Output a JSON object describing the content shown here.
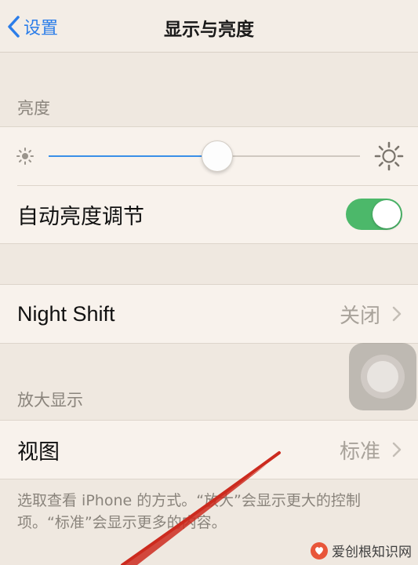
{
  "nav": {
    "back_label": "设置",
    "title": "显示与亮度"
  },
  "brightness": {
    "header": "亮度",
    "level_fraction": 0.54,
    "auto_label": "自动亮度调节",
    "auto_on": true
  },
  "night_shift": {
    "label": "Night Shift",
    "value": "关闭"
  },
  "zoom": {
    "header": "放大显示",
    "view_label": "视图",
    "view_value": "标准",
    "footer": "选取查看 iPhone 的方式。“放大”会显示更大的控制项。“标准”会显示更多的内容。"
  },
  "watermark": {
    "text": "爱创根知识网"
  },
  "colors": {
    "accent_blue": "#2b7de9",
    "toggle_green": "#4cb86a",
    "arrow_red": "#cc2a1e"
  },
  "icons": {
    "back": "chevron-left-icon",
    "brightness_low": "sun-small-icon",
    "brightness_high": "sun-large-icon",
    "disclosure": "chevron-right-icon",
    "assistive_touch": "assistive-touch-icon"
  }
}
